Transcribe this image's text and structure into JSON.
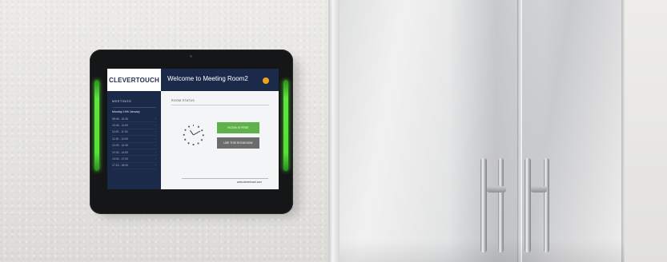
{
  "scene": {
    "led_color": "#57e036",
    "header_color": "#1c2a4a",
    "room_free_color": "#5fb24a",
    "status_dot_color": "#f0a21e"
  },
  "device": {
    "brand": "CLEVERTOUCH",
    "welcome": "Welcome to Meeting Room2",
    "status_icon": "status-dot-icon"
  },
  "sidebar": {
    "title": "MEETINGS",
    "date": "Monday 19th January",
    "slots": [
      "08:45 - 10:30",
      "10:45 - 11:00",
      "11:00 - 11:30",
      "11:30 - 12:00",
      "12:00 - 12:30",
      "12:30 - 14:00",
      "14:00 - 17:00",
      "17:15 - 18:00"
    ]
  },
  "main": {
    "title": "ROOM STATUS",
    "free_button": "ROOM IS FREE",
    "use_button": "USE THIS ROOM NOW",
    "website": "www.clevertouch.com",
    "clock_icon": "analog-clock-icon"
  }
}
